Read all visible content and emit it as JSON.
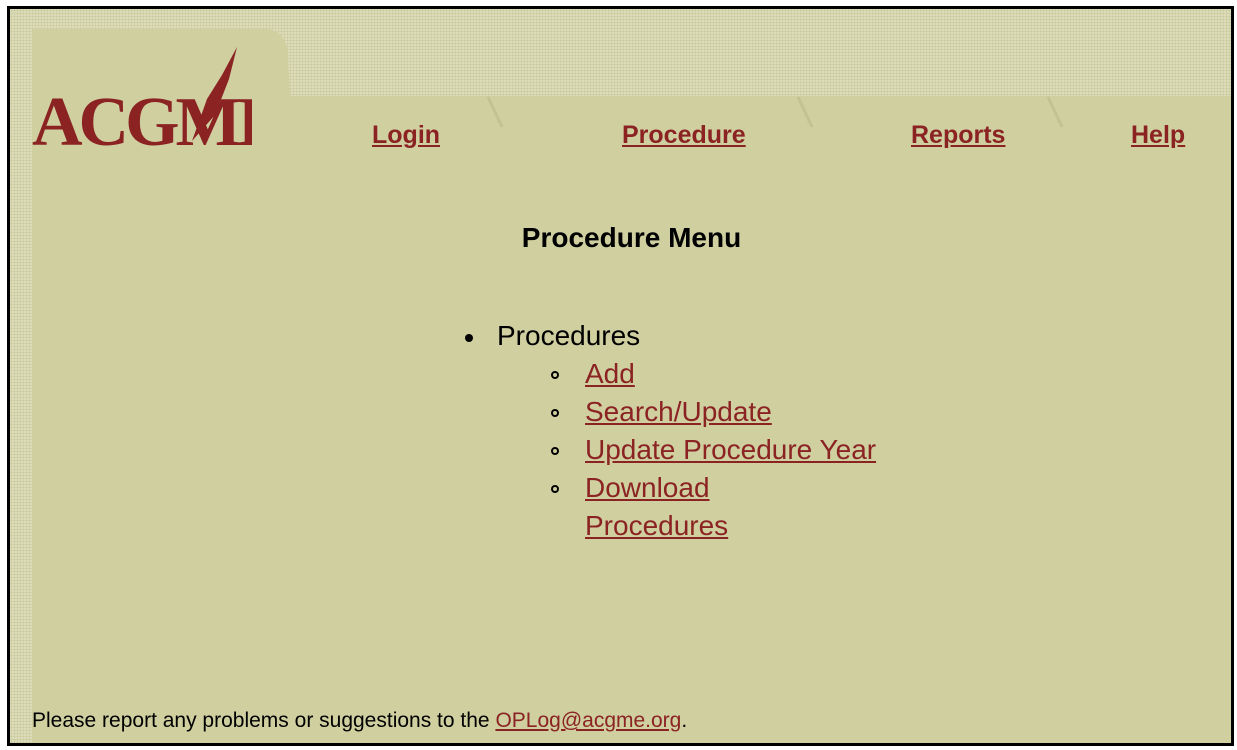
{
  "logo": {
    "text": "ACGME",
    "color": "#8b2323"
  },
  "tabs": [
    {
      "label": "Login"
    },
    {
      "label": "Procedure"
    },
    {
      "label": "Reports"
    },
    {
      "label": "Help"
    }
  ],
  "main": {
    "title": "Procedure Menu",
    "section_label": "Procedures",
    "items": [
      {
        "label": "Add"
      },
      {
        "label": "Search/Update"
      },
      {
        "label": "Update Procedure Year"
      },
      {
        "label": "Download Procedures"
      }
    ]
  },
  "footer": {
    "text": "Please report any problems or suggestions to the ",
    "link": "OPLog@acgme.org",
    "end": "."
  },
  "colors": {
    "background": "#dcdcb8",
    "panel": "#cfcfa0",
    "accent": "#8b2323"
  }
}
